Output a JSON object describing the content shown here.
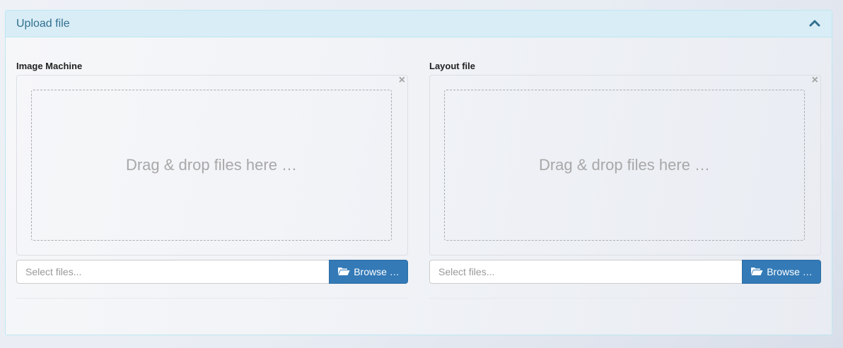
{
  "panel": {
    "title": "Upload file",
    "collapse_icon": "chevron-up-icon"
  },
  "uploaders": [
    {
      "label": "Image Machine",
      "drop_text": "Drag & drop files here …",
      "close_symbol": "×",
      "placeholder": "Select files...",
      "browse_label": "Browse …",
      "browse_icon": "folder-open-icon"
    },
    {
      "label": "Layout file",
      "drop_text": "Drag & drop files here …",
      "close_symbol": "×",
      "placeholder": "Select files...",
      "browse_label": "Browse …",
      "browse_icon": "folder-open-icon"
    }
  ],
  "colors": {
    "heading_bg": "#d9edf7",
    "heading_text": "#31708f",
    "button_primary": "#337ab7"
  }
}
